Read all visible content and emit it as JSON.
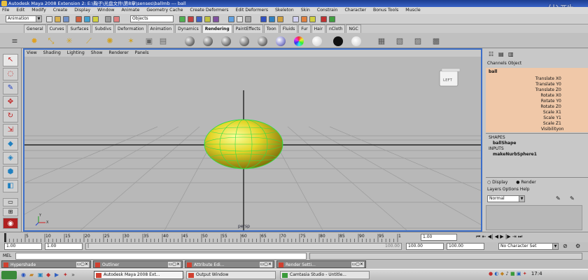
{
  "window": {
    "title": "Autodesk Maya 2008 Extension 2: E:\\鞠子\\光盘文件\\第8章\\senses\\ballmb  ---  ball",
    "watermark": "优酷"
  },
  "menubar": [
    "File",
    "Edit",
    "Modify",
    "Create",
    "Display",
    "Window",
    "Animate",
    "Geometry Cache",
    "Create Deformers",
    "Edit Deformers",
    "Skeleton",
    "Skin",
    "Constrain",
    "Character",
    "Bonus Tools",
    "Muscle"
  ],
  "statusline": {
    "mode": "Animation",
    "selection_field": "Objects"
  },
  "shelf_tabs": [
    "General",
    "Curves",
    "Surfaces",
    "Subdivs",
    "Deformation",
    "Animation",
    "Dynamics",
    "Rendering",
    "PaintEffects",
    "Toon",
    "Fluids",
    "Fur",
    "Hair",
    "nCloth",
    "NGC"
  ],
  "shelf_active": "Rendering",
  "viewport": {
    "menu": [
      "View",
      "Shading",
      "Lighting",
      "Show",
      "Renderer",
      "Panels"
    ],
    "camera_label": "persp",
    "viewcube_label": "LEFT",
    "axis_y": "Y",
    "axis_x": "X",
    "colors": {
      "sphere": "#e4d62a",
      "wire": "#33dd44",
      "selected_border": "#3c6ec8",
      "bg": "#b8b8b8"
    }
  },
  "channels": {
    "menu": [
      "Channels",
      "Object"
    ],
    "object": "ball",
    "attributes": [
      {
        "name": "Translate X",
        "value": "0"
      },
      {
        "name": "Translate Y",
        "value": "0"
      },
      {
        "name": "Translate Z",
        "value": "0"
      },
      {
        "name": "Rotate X",
        "value": "0"
      },
      {
        "name": "Rotate Y",
        "value": "0"
      },
      {
        "name": "Rotate Z",
        "value": "0"
      },
      {
        "name": "Scale X",
        "value": "1"
      },
      {
        "name": "Scale Y",
        "value": "1"
      },
      {
        "name": "Scale Z",
        "value": "1"
      },
      {
        "name": "Visibility",
        "value": "on"
      }
    ],
    "shapes_header": "SHAPES",
    "shape_name": "ballShape",
    "inputs_header": "INPUTS",
    "input_name": "makeNurbSphere1",
    "layer_tabs": {
      "display": "Display",
      "render": "Render"
    },
    "layer_menu": [
      "Layers",
      "Options",
      "Help"
    ],
    "layer_mode": "Normal"
  },
  "timeline": {
    "ticks": [
      "5",
      "10",
      "15",
      "20",
      "25",
      "30",
      "35",
      "40",
      "45",
      "50",
      "55",
      "60",
      "65",
      "70",
      "75",
      "80",
      "85",
      "90",
      "95",
      "1"
    ],
    "current_frame": "1.00"
  },
  "range": {
    "start": "1.00",
    "playback_start": "1.00",
    "playback_end_label": "100.00",
    "end_a": "100.00",
    "end_b": "100.00",
    "character_set": "No Character Set"
  },
  "command_line": {
    "label": "MEL"
  },
  "minimized_windows": [
    "Hypershade",
    "Outliner",
    "Attribute Edi...",
    "Render Setti..."
  ],
  "taskbar": {
    "tasks": [
      "Autodesk Maya 2008 Ext...",
      "Output Window",
      "Camtasia Studio - Untitle..."
    ],
    "clock": "17:4"
  }
}
